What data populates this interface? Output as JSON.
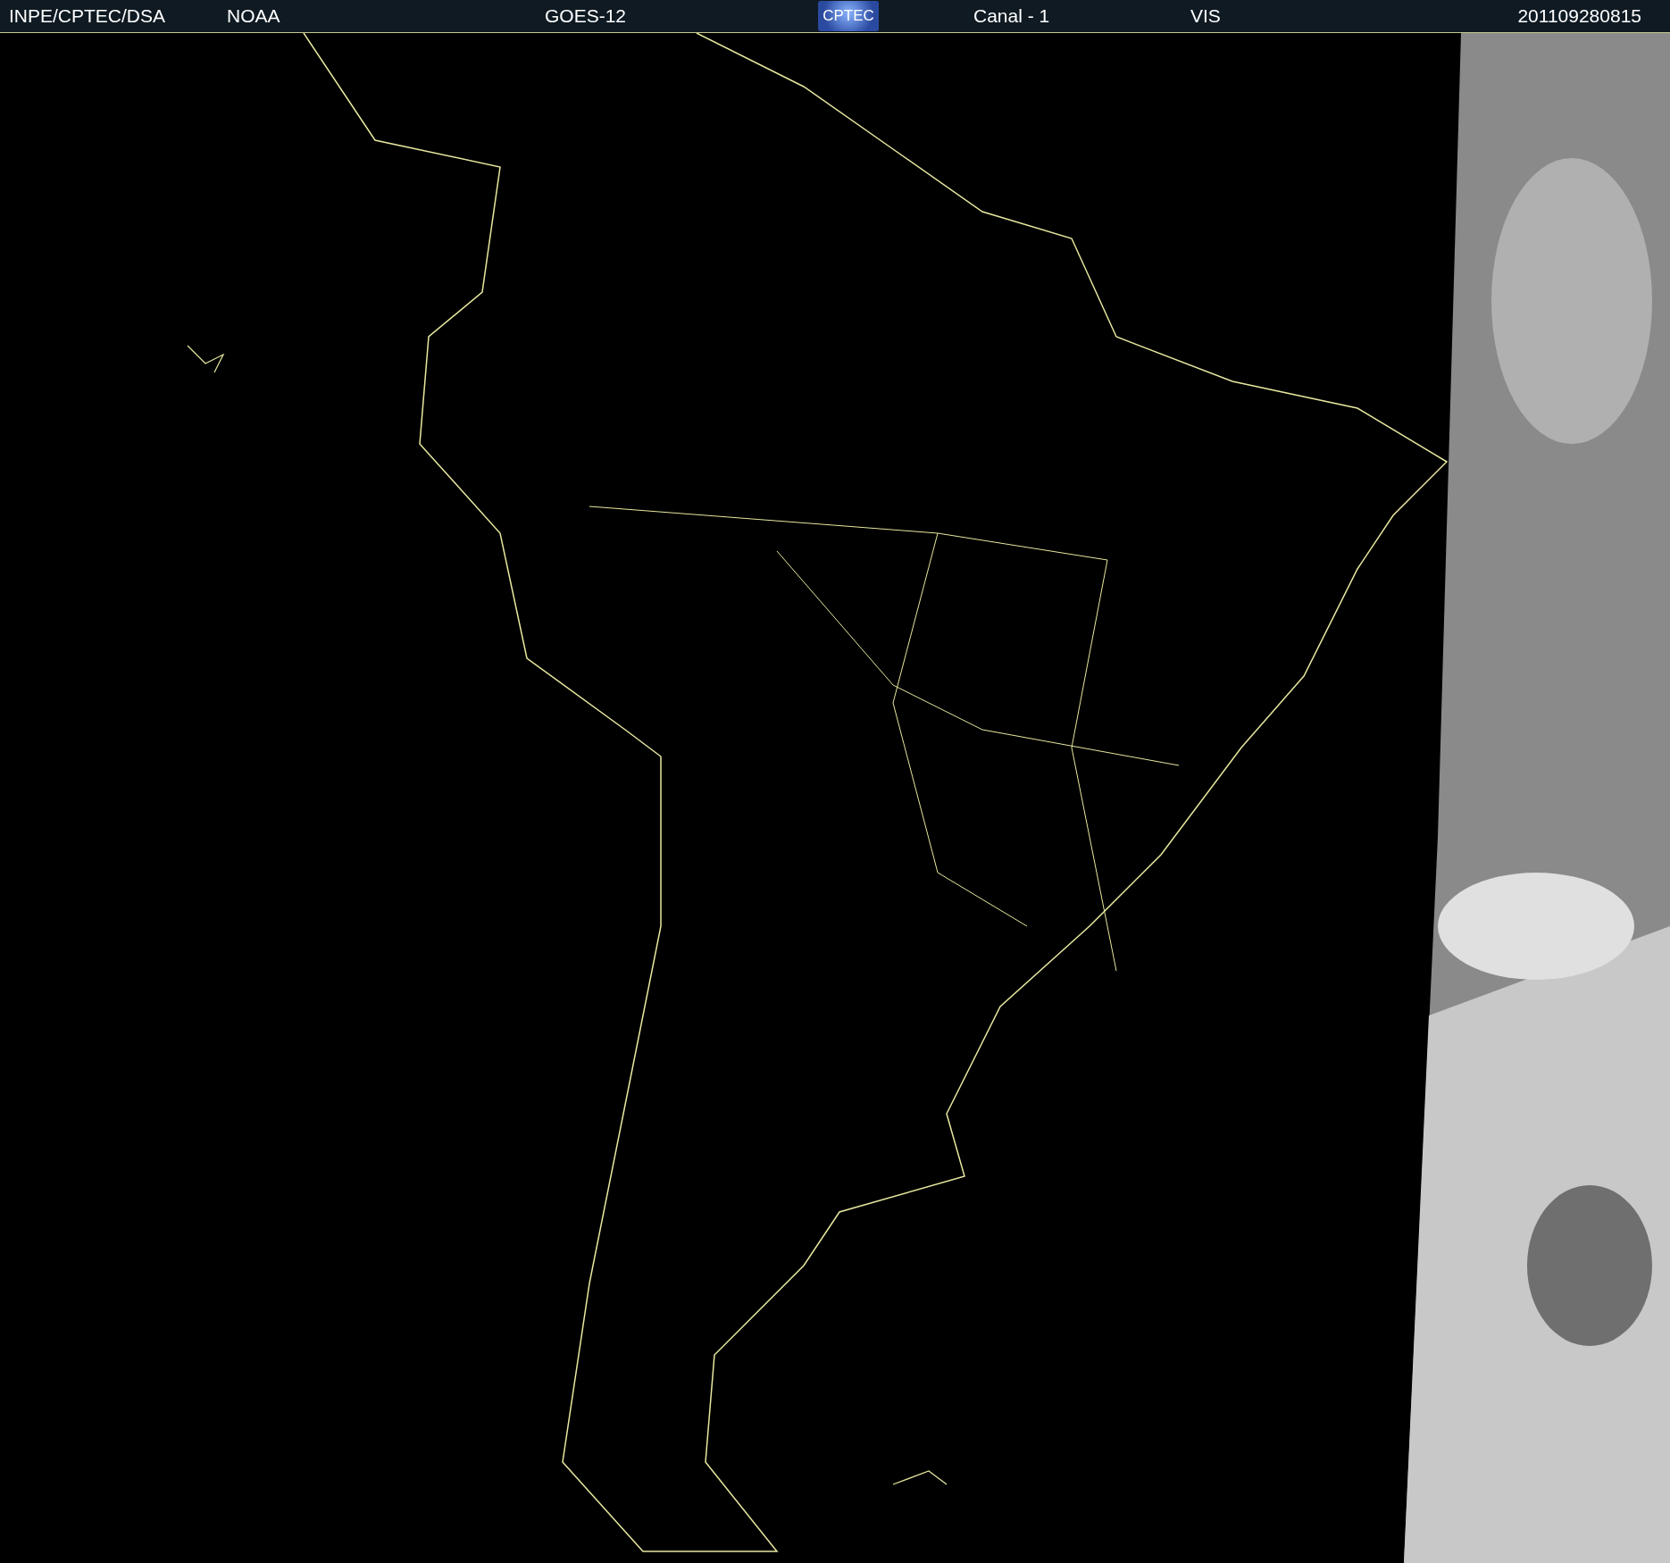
{
  "header": {
    "source": "INPE/CPTEC/DSA",
    "agency": "NOAA",
    "satellite": "GOES-12",
    "logo": "CPTEC",
    "channel": "Canal - 1",
    "band": "VIS",
    "timestamp": "201109280815"
  }
}
